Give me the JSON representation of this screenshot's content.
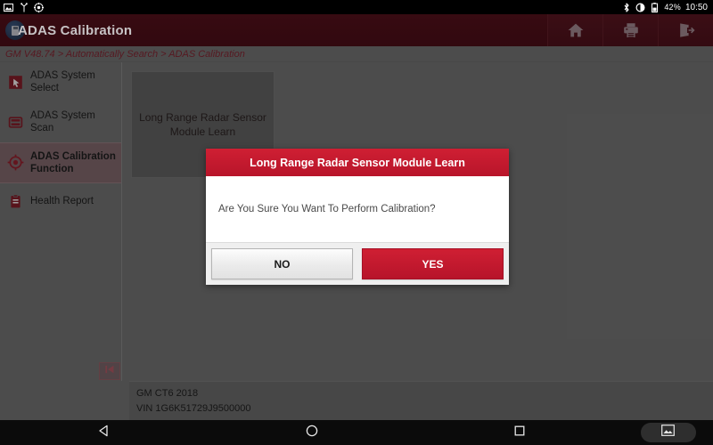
{
  "statusbar": {
    "left_icons": [
      "screenshot-icon",
      "usb-debug-icon",
      "settings-gear-icon"
    ],
    "bluetooth_icon": "bluetooth-icon",
    "brightness_icon": "brightness-contrast-icon",
    "battery_icon": "battery-icon",
    "battery_percent": "42%",
    "time": "10:50"
  },
  "header": {
    "title": "ADAS Calibration",
    "logo_icon": "app-logo-icon",
    "actions": [
      {
        "name": "home-button",
        "icon": "home-icon"
      },
      {
        "name": "print-button",
        "icon": "printer-icon"
      },
      {
        "name": "exit-button",
        "icon": "exit-icon"
      }
    ]
  },
  "breadcrumb": {
    "text": "GM V48.74 > Automatically Search > ADAS Calibration"
  },
  "sidebar": {
    "items": [
      {
        "label": "ADAS System Select",
        "icon": "cursor-select-icon",
        "active": false
      },
      {
        "label": "ADAS System Scan",
        "icon": "scan-list-icon",
        "active": false
      },
      {
        "label": "ADAS Calibration Function",
        "icon": "crosshair-target-icon",
        "active": true
      },
      {
        "label": "Health Report",
        "icon": "clipboard-report-icon",
        "active": false
      }
    ],
    "collapse_icon": "collapse-left-icon"
  },
  "main": {
    "cards": [
      {
        "label": "Long Range Radar Sensor Module Learn"
      }
    ]
  },
  "vehicle_info": {
    "model": "GM CT6 2018",
    "vin": "VIN 1G6K51729J9500000"
  },
  "dialog": {
    "title": "Long Range Radar Sensor Module Learn",
    "message": "Are You Sure You Want To Perform Calibration?",
    "no_label": "NO",
    "yes_label": "YES"
  },
  "navbar": {
    "back_icon": "back-triangle-icon",
    "home_icon": "home-circle-icon",
    "recents_icon": "recents-square-icon",
    "screenshot_icon": "screenshot-image-icon"
  },
  "colors": {
    "brand_dark_red": "#4a1019",
    "accent_red": "#c41230",
    "background_gray": "#6e6e6e",
    "sidebar_active": "#7b6468",
    "breadcrumb_text": "#7c2430"
  }
}
